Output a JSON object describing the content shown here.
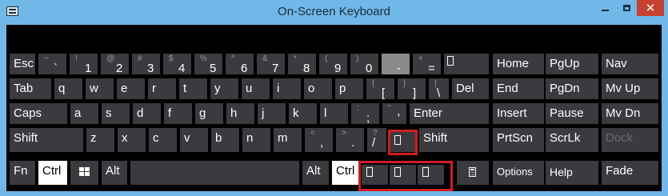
{
  "window": {
    "title": "On-Screen Keyboard",
    "close_label": "✕"
  },
  "keys": {
    "esc": "Esc",
    "tab": "Tab",
    "caps": "Caps",
    "shift_l": "Shift",
    "fn": "Fn",
    "ctrl_l": "Ctrl",
    "alt_l": "Alt",
    "alt_r": "Alt",
    "ctrl_r": "Ctrl",
    "del": "Del",
    "enter": "Enter",
    "shift_r": "Shift",
    "home": "Home",
    "pgup": "PgUp",
    "nav": "Nav",
    "end": "End",
    "pgdn": "PgDn",
    "mvup": "Mv Up",
    "insert": "Insert",
    "pause": "Pause",
    "mvdn": "Mv Dn",
    "prtscn": "PrtScn",
    "scrlk": "ScrLk",
    "dock": "Dock",
    "options": "Options",
    "help": "Help",
    "fade": "Fade"
  },
  "numrow": [
    {
      "up": "~",
      "dn": "`"
    },
    {
      "up": "!",
      "dn": "1"
    },
    {
      "up": "@",
      "dn": "2"
    },
    {
      "up": "#",
      "dn": "3"
    },
    {
      "up": "$",
      "dn": "4"
    },
    {
      "up": "%",
      "dn": "5"
    },
    {
      "up": "^",
      "dn": "6"
    },
    {
      "up": "&",
      "dn": "7"
    },
    {
      "up": "*",
      "dn": "8"
    },
    {
      "up": "(",
      "dn": "9"
    },
    {
      "up": ")",
      "dn": "0"
    },
    {
      "up": "_",
      "dn": "-"
    },
    {
      "up": "+",
      "dn": "="
    }
  ],
  "row_q": [
    "q",
    "w",
    "e",
    "r",
    "t",
    "y",
    "u",
    "i",
    "o",
    "p"
  ],
  "row_q_sym": [
    {
      "up": "{",
      "dn": "["
    },
    {
      "up": "}",
      "dn": "]"
    },
    {
      "up": "|",
      "dn": "\\"
    }
  ],
  "row_a": [
    "a",
    "s",
    "d",
    "f",
    "g",
    "h",
    "j",
    "k",
    "l"
  ],
  "row_a_sym": [
    {
      "up": ":",
      "dn": ";"
    },
    {
      "up": "\"",
      "dn": "'"
    }
  ],
  "row_z": [
    "z",
    "x",
    "c",
    "v",
    "b",
    "n",
    "m"
  ],
  "row_z_sym": [
    {
      "up": "<",
      "dn": ","
    },
    {
      "up": ">",
      "dn": "."
    },
    {
      "up": "?",
      "dn": "/"
    }
  ]
}
